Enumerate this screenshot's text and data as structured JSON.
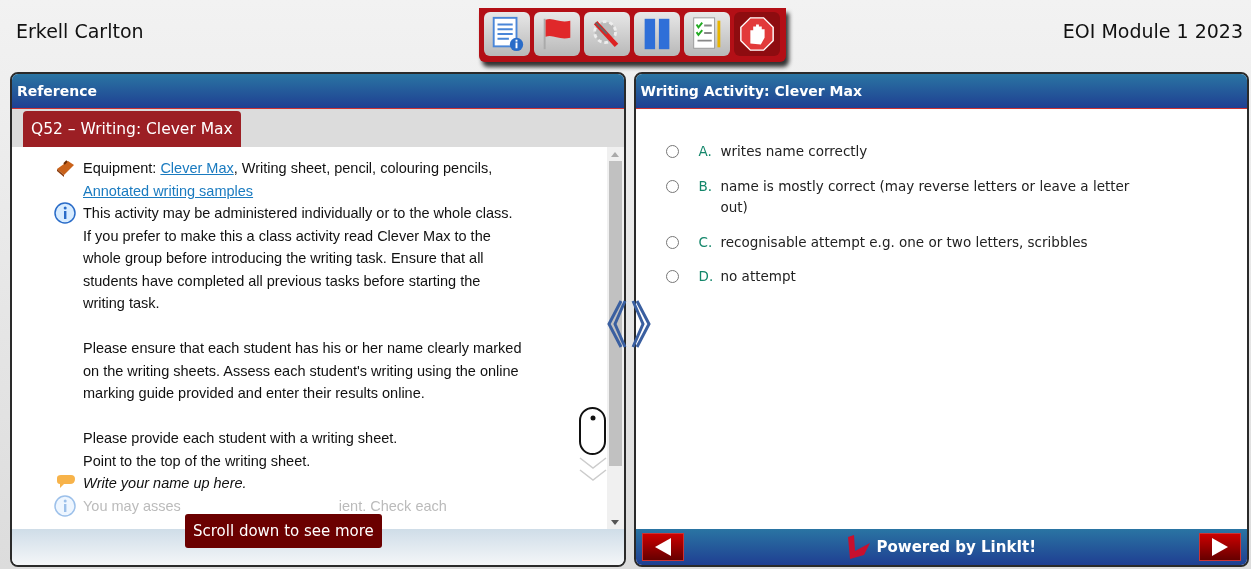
{
  "header": {
    "user": "Erkell Carlton",
    "title": "EOI Module 1 2023",
    "toolbar": [
      {
        "kind": "info"
      },
      {
        "kind": "flag"
      },
      {
        "kind": "tools"
      },
      {
        "kind": "pause"
      },
      {
        "kind": "checklist"
      },
      {
        "kind": "stop"
      }
    ]
  },
  "reference": {
    "title": "Reference",
    "tab": {
      "label": "Q52 – Writing: Clever Max",
      "selected": true
    },
    "items": [
      {
        "kind": "equipment",
        "segments": [
          {
            "kind": "text",
            "text": "Equipment: "
          },
          {
            "kind": "link",
            "text": "Clever Max"
          },
          {
            "kind": "text",
            "text": ", Writing sheet, pencil, colouring pencils,\n"
          },
          {
            "kind": "link",
            "text": "Annotated writing samples"
          }
        ]
      },
      {
        "kind": "info",
        "text": "This activity may be administered individually or to the whole class.\nIf you prefer to make this a class activity read Clever Max to the\nwhole group before introducing the writing task. Ensure that all\nstudents have completed all previous tasks before starting the\nwriting task."
      },
      {
        "kind": "plain",
        "text": "Please ensure that each student has his or her name clearly marked\non the writing sheets. Assess each student's writing using the online\nmarking guide provided and enter their results online."
      },
      {
        "kind": "plain",
        "text": "Please provide each student with a writing sheet.\nPoint to the top of the writing sheet."
      },
      {
        "kind": "speech",
        "text": "Write your name up here."
      },
      {
        "kind": "faded-info",
        "parts": [
          "You may asses",
          "ient. Check each"
        ]
      }
    ],
    "scroll_hint": "Scroll down to see more"
  },
  "activity": {
    "title": "Writing Activity: Clever Max",
    "options": [
      {
        "letter": "A.",
        "text": "writes name correctly",
        "selected": false
      },
      {
        "letter": "B.",
        "text": "name is mostly correct (may reverse letters or leave a letter\nout)",
        "selected": false
      },
      {
        "letter": "C.",
        "text": "recognisable attempt e.g. one or two letters, scribbles",
        "selected": false
      },
      {
        "letter": "D.",
        "text": "no attempt",
        "selected": false
      }
    ],
    "footer": "Powered by LinkIt!"
  }
}
